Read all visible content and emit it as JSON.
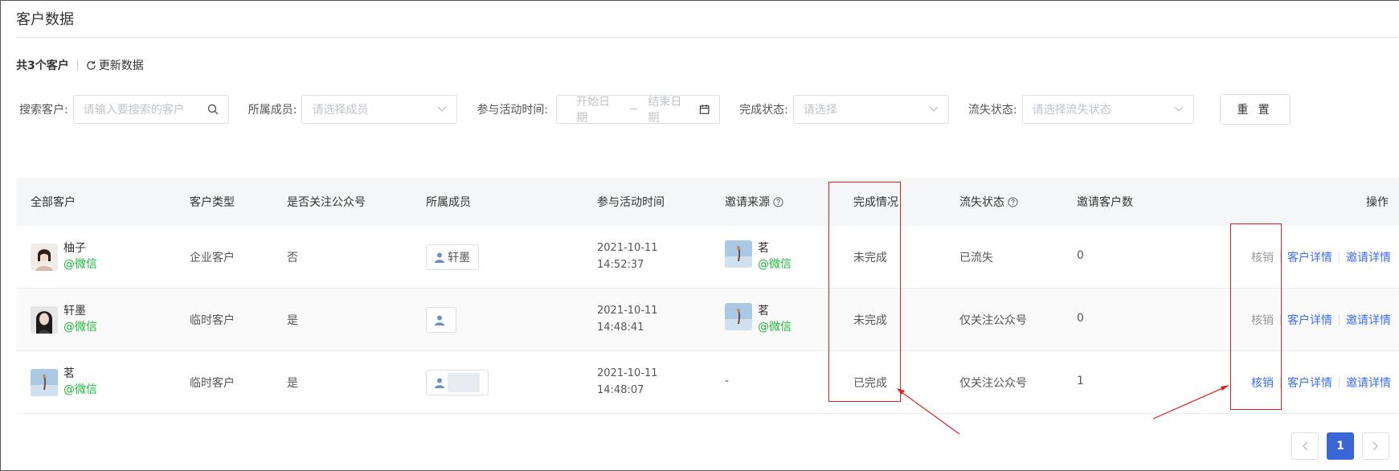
{
  "page": {
    "title": "客户数据"
  },
  "summary": {
    "total": "共3个客户",
    "refresh": "更新数据"
  },
  "filters": {
    "search_label": "搜索客户:",
    "search_placeholder": "请输入要搜索的客户",
    "member_label": "所属成员:",
    "member_placeholder": "请选择成员",
    "time_label": "参与活动时间:",
    "start_placeholder": "开始日期",
    "range_sep": "~",
    "end_placeholder": "结束日期",
    "complete_label": "完成状态:",
    "complete_placeholder": "请选择",
    "loss_label": "流失状态:",
    "loss_placeholder": "请选择流失状态",
    "reset": "重 置"
  },
  "table": {
    "headers": {
      "customer": "全部客户",
      "type": "客户类型",
      "follow": "是否关注公众号",
      "member": "所属成员",
      "time": "参与活动时间",
      "source": "邀请来源",
      "complete": "完成情况",
      "loss": "流失状态",
      "invites": "邀请客户数",
      "ops": "操作"
    },
    "rows": [
      {
        "name": "柚子",
        "wechat": "@微信",
        "type": "企业客户",
        "follow": "否",
        "member": "轩墨",
        "date": "2021-10-11",
        "time": "14:52:37",
        "source_name": "茗",
        "source_wechat": "@微信",
        "complete": "未完成",
        "loss": "已流失",
        "invites": "0",
        "act_verify": "核销",
        "act_detail": "客户详情",
        "act_invite": "邀请详情"
      },
      {
        "name": "轩墨",
        "wechat": "@微信",
        "type": "临时客户",
        "follow": "是",
        "member": "",
        "date": "2021-10-11",
        "time": "14:48:41",
        "source_name": "茗",
        "source_wechat": "@微信",
        "complete": "未完成",
        "loss": "仅关注公众号",
        "invites": "0",
        "act_verify": "核销",
        "act_detail": "客户详情",
        "act_invite": "邀请详情"
      },
      {
        "name": "茗",
        "wechat": "@微信",
        "type": "临时客户",
        "follow": "是",
        "member": "",
        "date": "2021-10-11",
        "time": "14:48:07",
        "source_dash": "-",
        "complete": "已完成",
        "loss": "仅关注公众号",
        "invites": "1",
        "act_verify": "核销",
        "act_detail": "客户详情",
        "act_invite": "邀请详情"
      }
    ]
  },
  "pagination": {
    "current": "1"
  },
  "colors": {
    "accent": "#3b6ef6",
    "wechat": "#1cb93b",
    "annotation": "#e0211f"
  }
}
